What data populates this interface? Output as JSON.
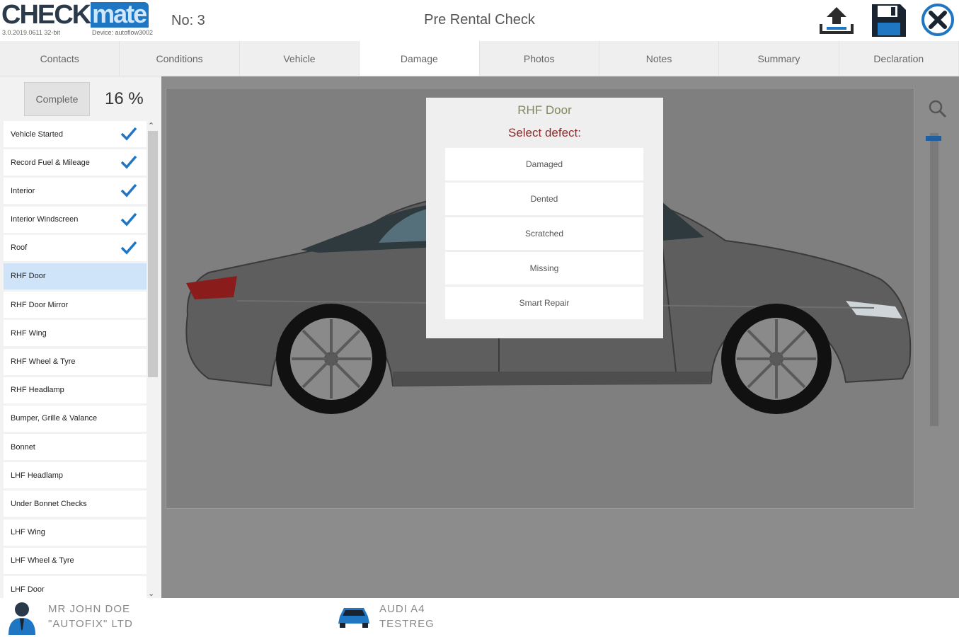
{
  "header": {
    "logo_check": "CHECK",
    "logo_mate": "mate",
    "version": "3.0.2019.0611 32-bit",
    "device": "Device: autoflow3002",
    "check_number": "No: 3",
    "title": "Pre Rental Check",
    "icons": [
      "upload-icon",
      "save-icon",
      "close-icon"
    ]
  },
  "tabs": [
    {
      "label": "Contacts",
      "active": false
    },
    {
      "label": "Conditions",
      "active": false
    },
    {
      "label": "Vehicle",
      "active": false
    },
    {
      "label": "Damage",
      "active": true
    },
    {
      "label": "Photos",
      "active": false
    },
    {
      "label": "Notes",
      "active": false
    },
    {
      "label": "Summary",
      "active": false
    },
    {
      "label": "Declaration",
      "active": false
    }
  ],
  "sidebar": {
    "complete_label": "Complete",
    "percent": "16 %",
    "items": [
      {
        "label": "Vehicle Started",
        "done": true,
        "selected": false
      },
      {
        "label": "Record Fuel & Mileage",
        "done": true,
        "selected": false
      },
      {
        "label": "Interior",
        "done": true,
        "selected": false
      },
      {
        "label": "Interior Windscreen",
        "done": true,
        "selected": false
      },
      {
        "label": "Roof",
        "done": true,
        "selected": false
      },
      {
        "label": "RHF Door",
        "done": false,
        "selected": true
      },
      {
        "label": "RHF Door Mirror",
        "done": false,
        "selected": false
      },
      {
        "label": "RHF Wing",
        "done": false,
        "selected": false
      },
      {
        "label": "RHF Wheel & Tyre",
        "done": false,
        "selected": false
      },
      {
        "label": "RHF Headlamp",
        "done": false,
        "selected": false
      },
      {
        "label": "Bumper, Grille & Valance",
        "done": false,
        "selected": false
      },
      {
        "label": "Bonnet",
        "done": false,
        "selected": false
      },
      {
        "label": "LHF Headlamp",
        "done": false,
        "selected": false
      },
      {
        "label": "Under Bonnet Checks",
        "done": false,
        "selected": false
      },
      {
        "label": "LHF Wing",
        "done": false,
        "selected": false
      },
      {
        "label": "LHF Wheel & Tyre",
        "done": false,
        "selected": false
      },
      {
        "label": "LHF Door",
        "done": false,
        "selected": false
      }
    ]
  },
  "popup": {
    "title": "RHF Door",
    "subtitle": "Select defect:",
    "options": [
      "Damaged",
      "Dented",
      "Scratched",
      "Missing",
      "Smart Repair"
    ]
  },
  "footer": {
    "customer_name": "MR JOHN DOE",
    "customer_company": "\"AUTOFIX\" LTD",
    "vehicle_model": "AUDI A4",
    "vehicle_reg": "TESTREG"
  },
  "colors": {
    "accent": "#1f77c4",
    "tick": "#1f77c4",
    "selected_row": "#cfe4f8",
    "popup_title": "#7f8a5f",
    "popup_subtitle": "#8a2b2b",
    "canvas_bg": "#7f7f7f"
  }
}
